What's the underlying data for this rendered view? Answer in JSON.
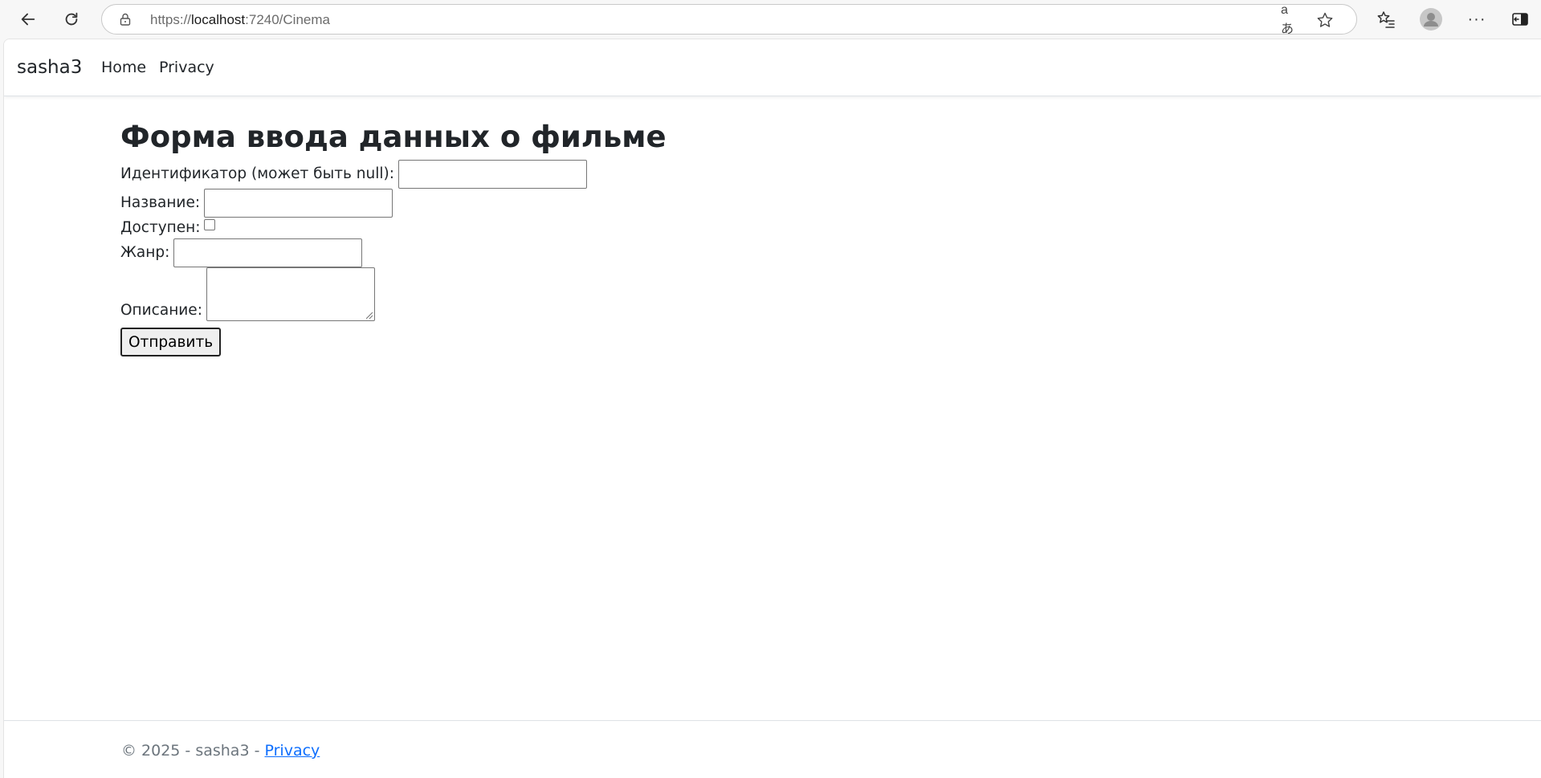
{
  "browser": {
    "url_prefix": "https://",
    "url_host": "localhost",
    "url_rest": ":7240/Cinema",
    "icons": [
      "back-arrow-icon",
      "reload-icon",
      "lock-icon",
      "translate-icon",
      "star-icon",
      "favorites-icon",
      "profile-icon",
      "more-icon",
      "sidebar-icon"
    ],
    "translate_glyph": "aあ",
    "more_glyph": "···"
  },
  "navbar": {
    "brand": "sasha3",
    "links": [
      {
        "label": "Home"
      },
      {
        "label": "Privacy"
      }
    ]
  },
  "form": {
    "title": "Форма ввода данных о фильме",
    "id_label": "Идентификатор (может быть null):",
    "id_value": "",
    "name_label": "Название:",
    "name_value": "",
    "available_label": "Доступен:",
    "available_checked": false,
    "genre_label": "Жанр:",
    "genre_value": "",
    "description_label": "Описание:",
    "description_value": "",
    "submit_label": "Отправить"
  },
  "footer": {
    "copyright": "© 2025 - sasha3 - ",
    "privacy_link": "Privacy"
  },
  "colors": {
    "link": "#0d6efd",
    "muted": "#6c757d",
    "text": "#212529"
  }
}
